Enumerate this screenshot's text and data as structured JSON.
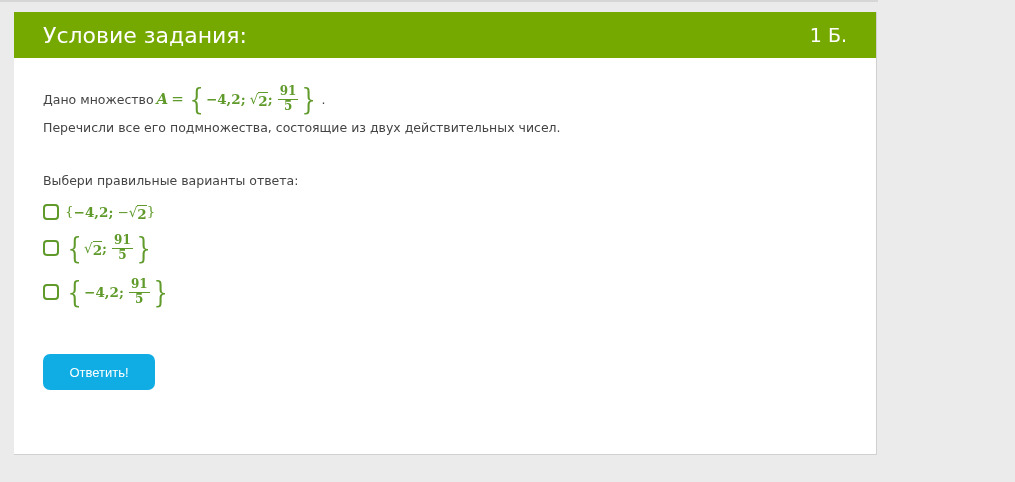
{
  "header": {
    "title": "Условие задания:",
    "points": "1 Б."
  },
  "statement": {
    "intro": "Дано множество",
    "set_name": "A",
    "equals": "=",
    "set": {
      "open": "{",
      "close": "}",
      "separator": ";",
      "elements": [
        {
          "kind": "number",
          "text": "−4,2"
        },
        {
          "kind": "sqrt",
          "symbol": "√",
          "radicand": "2"
        },
        {
          "kind": "fraction",
          "numerator": "91",
          "denominator": "5"
        }
      ]
    },
    "end": ".",
    "task": "Перечисли все его подмножества, состоящие из двух действительных чисел."
  },
  "prompt": "Выбери правильные варианты ответа:",
  "options": [
    {
      "checked": false,
      "set": {
        "open": "{",
        "close": "}",
        "separator": ";",
        "elements": [
          {
            "kind": "number",
            "text": "−4,2"
          },
          {
            "kind": "sqrt",
            "sign": "−",
            "symbol": "√",
            "radicand": "2"
          }
        ]
      }
    },
    {
      "checked": false,
      "set": {
        "open": "{",
        "close": "}",
        "separator": ";",
        "elements": [
          {
            "kind": "sqrt",
            "symbol": "√",
            "radicand": "2"
          },
          {
            "kind": "fraction",
            "numerator": "91",
            "denominator": "5"
          }
        ]
      }
    },
    {
      "checked": false,
      "set": {
        "open": "{",
        "close": "}",
        "separator": ";",
        "elements": [
          {
            "kind": "number",
            "text": "−4,2"
          },
          {
            "kind": "fraction",
            "numerator": "91",
            "denominator": "5"
          }
        ]
      }
    }
  ],
  "submit_button": "Ответить!"
}
